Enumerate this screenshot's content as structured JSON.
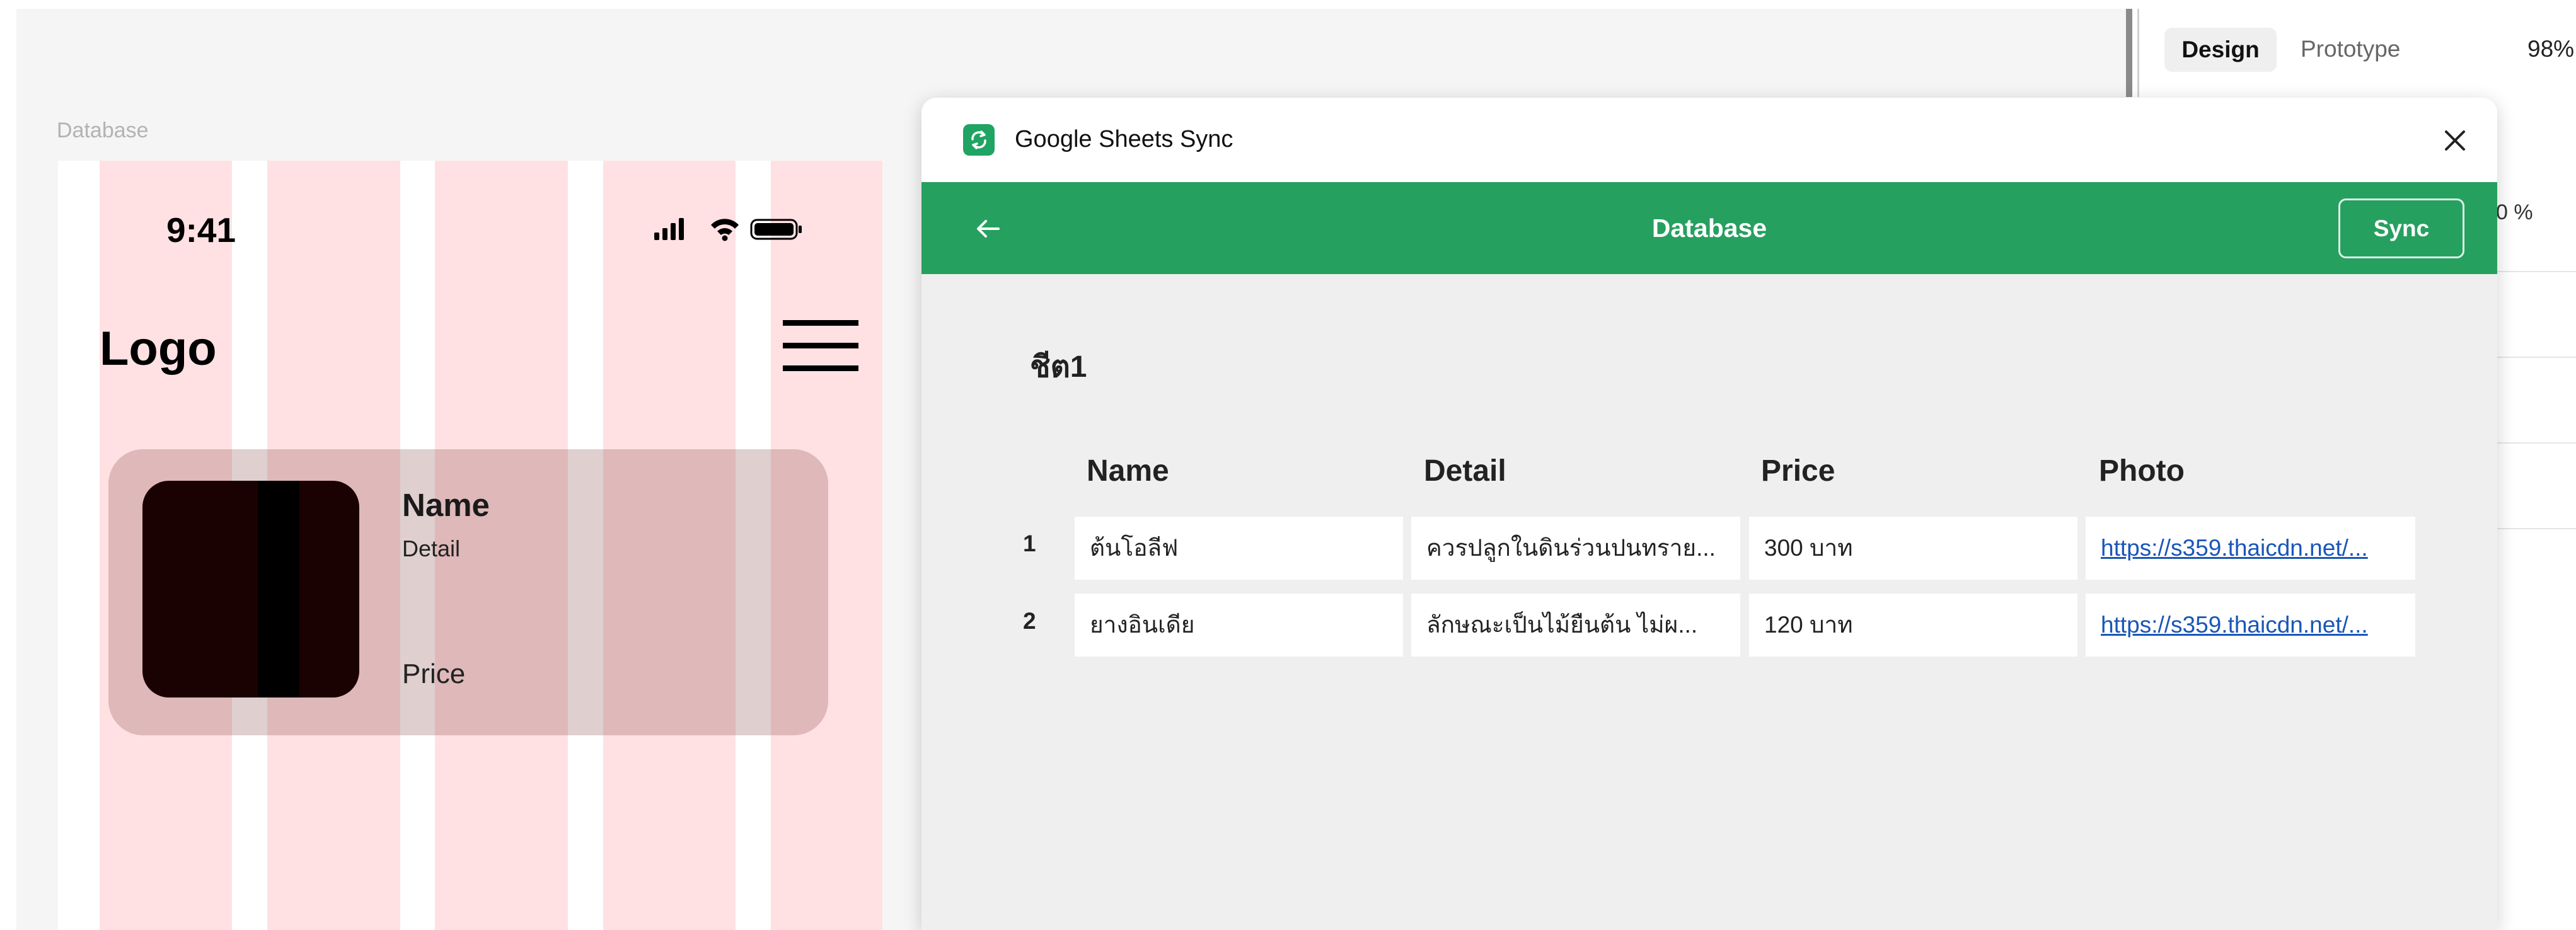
{
  "canvas": {
    "frame_label": "Database",
    "phone": {
      "status_time": "9:41",
      "logo": "Logo",
      "card": {
        "name": "Name",
        "detail": "Detail",
        "price": "Price"
      }
    }
  },
  "right_panel": {
    "tabs": [
      "Design",
      "Prototype"
    ],
    "zoom": "98%",
    "value_field": "0 %"
  },
  "plugin": {
    "title": "Google Sheets Sync",
    "header_title": "Database",
    "sync_label": "Sync",
    "sheet_name": "ชีต1",
    "columns": [
      "Name",
      "Detail",
      "Price",
      "Photo"
    ],
    "rows": [
      {
        "index": "1",
        "name": "ต้นโอลีฟ",
        "detail": "ควรปลูกในดินร่วนปนทราย...",
        "price": "300 บาท",
        "photo": "https://s359.thaicdn.net/..."
      },
      {
        "index": "2",
        "name": "ยางอินเดีย",
        "detail": "ลักษณะเป็นไม้ยืนต้น ไม่ผ...",
        "price": "120 บาท",
        "photo": "https://s359.thaicdn.net/..."
      }
    ]
  },
  "colors": {
    "header_green": "#26a05f",
    "grid_column_pink": "#ffe1e3",
    "link_blue": "#1a56b8"
  },
  "icons": [
    "sheets-sync-icon",
    "close-icon",
    "back-arrow-icon",
    "signal-icon",
    "wifi-icon",
    "battery-icon",
    "hamburger-menu-icon"
  ]
}
